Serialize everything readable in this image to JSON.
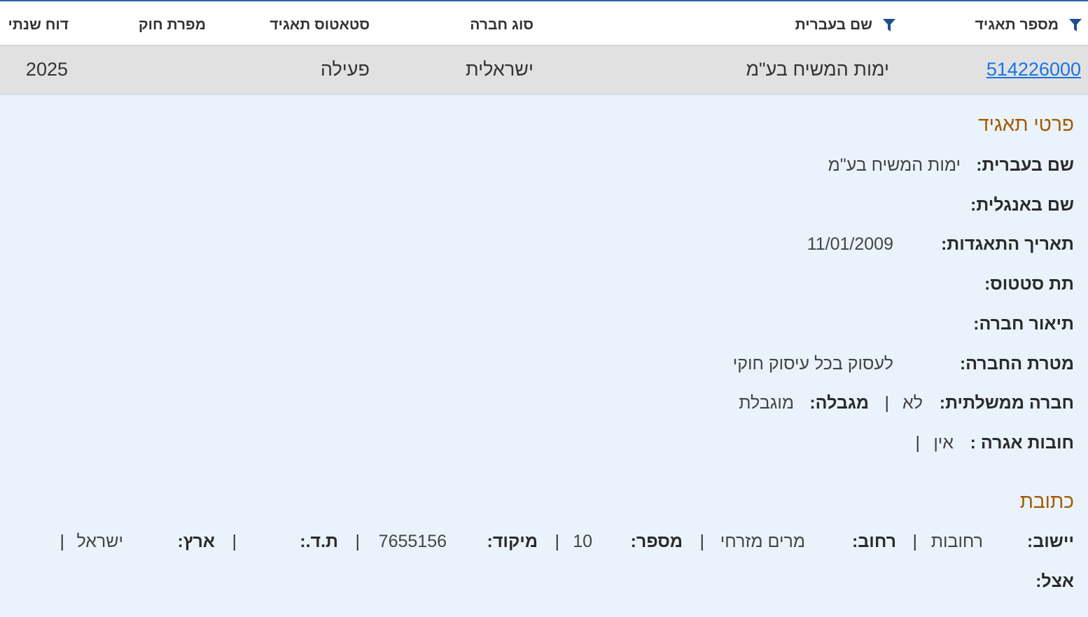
{
  "table": {
    "headers": {
      "reg_number": "מספר תאגיד",
      "hebrew_name": "שם בעברית",
      "company_type": "סוג חברה",
      "status": "סטאטוס תאגיד",
      "law_violator": "מפרת חוק",
      "annual_report": "דוח שנתי"
    },
    "row": {
      "reg_number": "514226000",
      "hebrew_name": "ימות המשיח בע\"מ",
      "company_type": "ישראלית",
      "status": "פעילה",
      "law_violator": "",
      "annual_report": "2025"
    }
  },
  "details": {
    "title": "פרטי תאגיד",
    "hebrew_name_label": "שם בעברית:",
    "hebrew_name_value": "ימות המשיח בע\"מ",
    "english_name_label": "שם באנגלית:",
    "english_name_value": "",
    "incorporation_date_label": "תאריך התאגדות:",
    "incorporation_date_value": "11/01/2009",
    "sub_status_label": "תת סטטוס:",
    "sub_status_value": "",
    "description_label": "תיאור חברה:",
    "description_value": "",
    "purpose_label": "מטרת החברה:",
    "purpose_value": "לעסוק בכל עיסוק חוקי",
    "government_label": "חברה ממשלתית:",
    "government_value": "לא",
    "limited_label": "מגבלה:",
    "limited_value": "מוגבלת",
    "fee_debt_label": "חובות אגרה :",
    "fee_debt_value": "אין",
    "separator": "|"
  },
  "address": {
    "title": "כתובת",
    "city_label": "יישוב:",
    "city_value": "רחובות",
    "street_label": "רחוב:",
    "street_value": "מרים מזרחי",
    "number_label": "מספר:",
    "number_value": "10",
    "zip_label": "מיקוד:",
    "zip_value": "7655156",
    "pobox_label": "ת.ד.:",
    "pobox_value": "",
    "country_label": "ארץ:",
    "country_value": "ישראל",
    "care_of_label": "אצל:",
    "care_of_value": ""
  },
  "icons": {
    "filter": "filter-icon"
  },
  "colors": {
    "header_border": "#2a62a6",
    "link": "#1a73e8",
    "section_title": "#a35a00",
    "row_bg": "#e1e1e1",
    "details_bg": "#eaf3fb",
    "filter_icon": "#1f4e8c"
  }
}
